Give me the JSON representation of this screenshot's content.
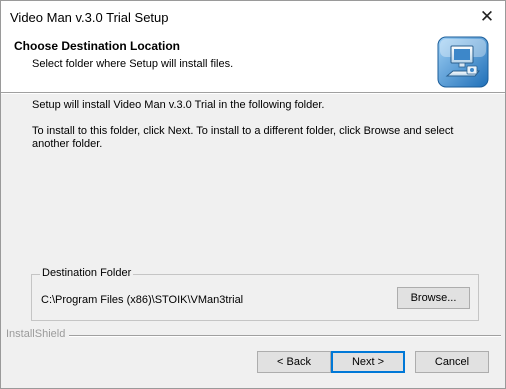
{
  "window": {
    "title": "Video Man v.3.0 Trial Setup",
    "close_glyph": "✕"
  },
  "header": {
    "title": "Choose Destination Location",
    "subtitle": "Select folder where Setup will install files.",
    "icon": "computer-setup-icon"
  },
  "body": {
    "line1": "Setup will install Video Man v.3.0 Trial in the following folder.",
    "line2": "To install to this folder, click Next. To install to a different folder, click Browse and select another folder."
  },
  "destination": {
    "legend": "Destination Folder",
    "path": "C:\\Program Files (x86)\\STOIK\\VMan3trial",
    "browse_label": "Browse..."
  },
  "footer": {
    "brand": "InstallShield",
    "back_label": "< Back",
    "next_label": "Next >",
    "cancel_label": "Cancel"
  },
  "colors": {
    "accent": "#0078d7",
    "dialog_bg": "#f0f0f0",
    "header_bg": "#ffffff"
  }
}
